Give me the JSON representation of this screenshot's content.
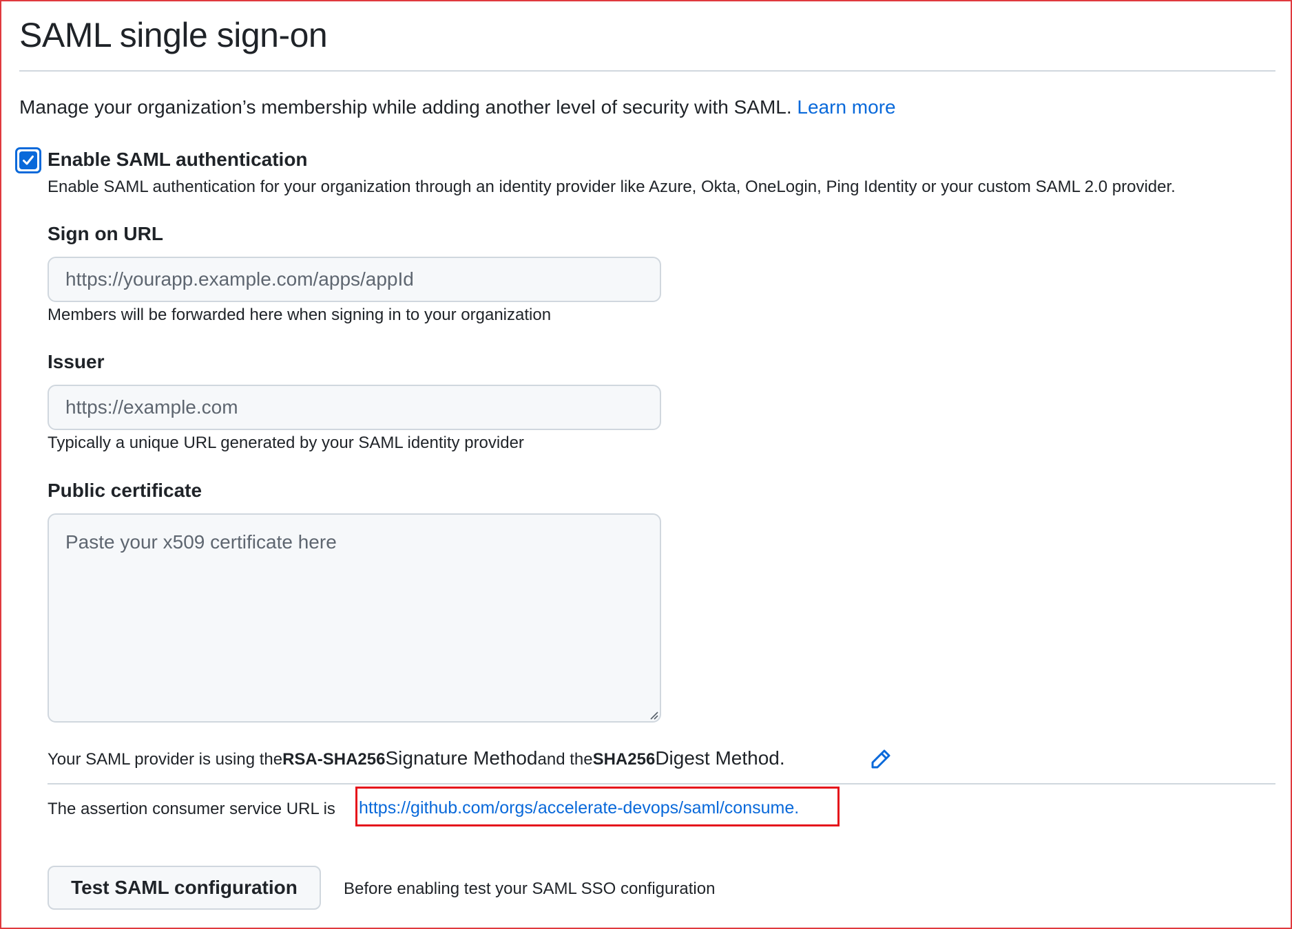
{
  "header": {
    "title": "SAML single sign-on"
  },
  "intro": {
    "text": "Manage your organization’s membership while adding another level of security with SAML. ",
    "learn_more": "Learn more"
  },
  "enable": {
    "checked": true,
    "label": "Enable SAML authentication",
    "description": "Enable SAML authentication for your organization through an identity provider like Azure, Okta, OneLogin, Ping Identity or your custom SAML 2.0 provider."
  },
  "sign_on_url": {
    "label": "Sign on URL",
    "placeholder": "https://yourapp.example.com/apps/appId",
    "value": "",
    "hint": "Members will be forwarded here when signing in to your organization"
  },
  "issuer": {
    "label": "Issuer",
    "placeholder": "https://example.com",
    "value": "",
    "hint": "Typically a unique URL generated by your SAML identity provider"
  },
  "certificate": {
    "label": "Public certificate",
    "placeholder": "Paste your x509 certificate here",
    "value": ""
  },
  "methods": {
    "prefix": "Your SAML provider is using the ",
    "signature_method": "RSA-SHA256",
    "signature_suffix": " Signature Method",
    "middle": " and the ",
    "digest_method": "SHA256",
    "digest_suffix": " Digest Method.",
    "edit_icon": "pencil-icon"
  },
  "acs": {
    "prefix": "The assertion consumer service URL is",
    "url": "https://github.com/orgs/accelerate-devops/saml/consume."
  },
  "test": {
    "button_label": "Test SAML configuration",
    "hint": "Before enabling test your SAML SSO configuration"
  },
  "colors": {
    "link": "#0969da",
    "highlight": "#e5131b",
    "frame": "#e0393e"
  }
}
